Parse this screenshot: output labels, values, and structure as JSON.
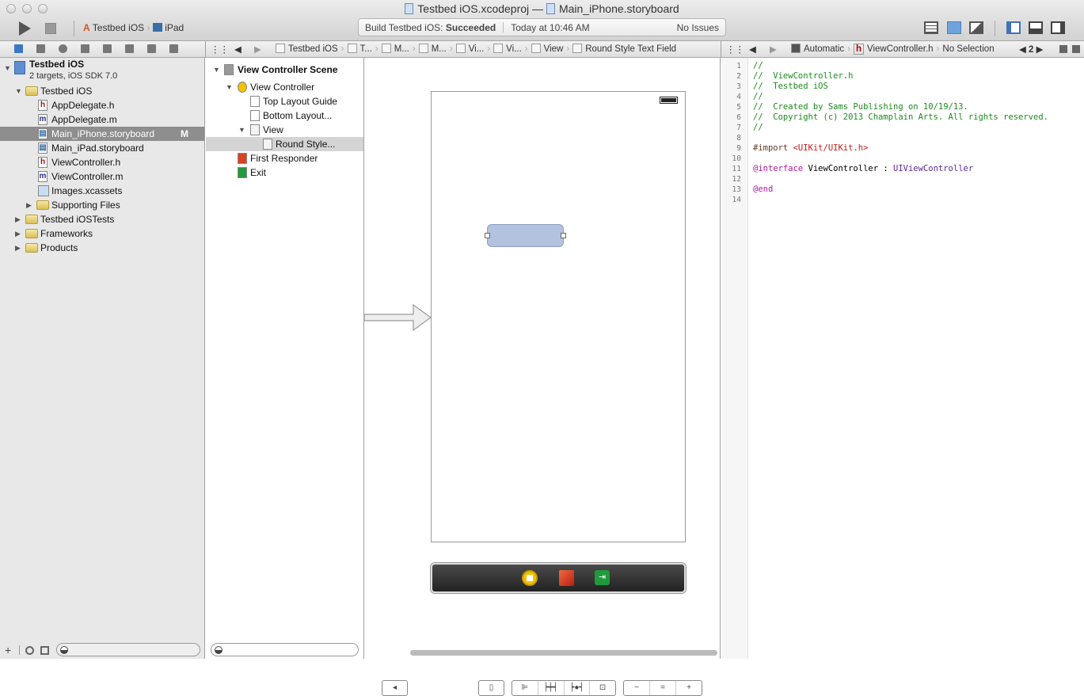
{
  "window": {
    "title_project": "Testbed iOS.xcodeproj",
    "title_separator": "—",
    "title_file": "Main_iPhone.storyboard"
  },
  "toolbar": {
    "run_icon": "play-icon",
    "stop_icon": "stop-icon",
    "scheme": "Testbed iOS",
    "destination": "iPad",
    "activity": {
      "label": "Build Testbed iOS:",
      "status": "Succeeded",
      "time": "Today at 10:46 AM",
      "issues": "No Issues"
    }
  },
  "navigator_tabs": [
    "folder-icon",
    "hierarchy-icon",
    "search-icon",
    "warning-icon",
    "test-icon",
    "debug-icon",
    "breakpoint-icon",
    "log-icon"
  ],
  "jumpbar_main": [
    "Testbed iOS",
    "T...",
    "M...",
    "M...",
    "Vi...",
    "Vi...",
    "View",
    "Round Style Text Field"
  ],
  "jumpbar_assistant": {
    "mode": "Automatic",
    "file": "ViewController.h",
    "selection": "No Selection",
    "counter": "2"
  },
  "navigator": {
    "project": {
      "name": "Testbed iOS",
      "subtitle": "2 targets, iOS SDK 7.0"
    },
    "items": [
      {
        "label": "Testbed iOS",
        "type": "folder",
        "expanded": true
      },
      {
        "label": "AppDelegate.h",
        "type": "h"
      },
      {
        "label": "AppDelegate.m",
        "type": "m"
      },
      {
        "label": "Main_iPhone.storyboard",
        "type": "storyboard",
        "selected": true,
        "badge": "M"
      },
      {
        "label": "Main_iPad.storyboard",
        "type": "storyboard"
      },
      {
        "label": "ViewController.h",
        "type": "h"
      },
      {
        "label": "ViewController.m",
        "type": "m"
      },
      {
        "label": "Images.xcassets",
        "type": "assets"
      },
      {
        "label": "Supporting Files",
        "type": "folder"
      },
      {
        "label": "Testbed iOSTests",
        "type": "folder"
      },
      {
        "label": "Frameworks",
        "type": "folder"
      },
      {
        "label": "Products",
        "type": "folder"
      }
    ]
  },
  "outline": {
    "scene": "View Controller Scene",
    "items": [
      "View Controller",
      "Top Layout Guide",
      "Bottom Layout...",
      "View",
      "Round Style...",
      "First Responder",
      "Exit"
    ]
  },
  "code": {
    "lines": [
      {
        "n": "1",
        "text": "//",
        "kind": "comment"
      },
      {
        "n": "2",
        "text": "//  ViewController.h",
        "kind": "comment"
      },
      {
        "n": "3",
        "text": "//  Testbed iOS",
        "kind": "comment"
      },
      {
        "n": "4",
        "text": "//",
        "kind": "comment"
      },
      {
        "n": "5",
        "text": "//  Created by Sams Publishing on 10/19/13.",
        "kind": "comment"
      },
      {
        "n": "6",
        "text": "//  Copyright (c) 2013 Champlain Arts. All rights reserved.",
        "kind": "comment"
      },
      {
        "n": "7",
        "text": "//",
        "kind": "comment"
      },
      {
        "n": "8",
        "text": "",
        "kind": "plain"
      },
      {
        "n": "9",
        "parts": [
          "#import ",
          "<UIKit/UIKit.h>"
        ]
      },
      {
        "n": "10",
        "text": "",
        "kind": "plain"
      },
      {
        "n": "11",
        "parts": [
          "@interface",
          " ViewController : ",
          "UIViewController"
        ]
      },
      {
        "n": "12",
        "text": "",
        "kind": "plain"
      },
      {
        "n": "13",
        "parts": [
          "@end"
        ]
      },
      {
        "n": "14",
        "text": "",
        "kind": "plain"
      }
    ]
  },
  "colors": {
    "comment": "#1c8a1c",
    "string": "#c41a16",
    "keyword": "#b5179b",
    "class": "#5c2699",
    "selection": "#8e8e8e"
  }
}
